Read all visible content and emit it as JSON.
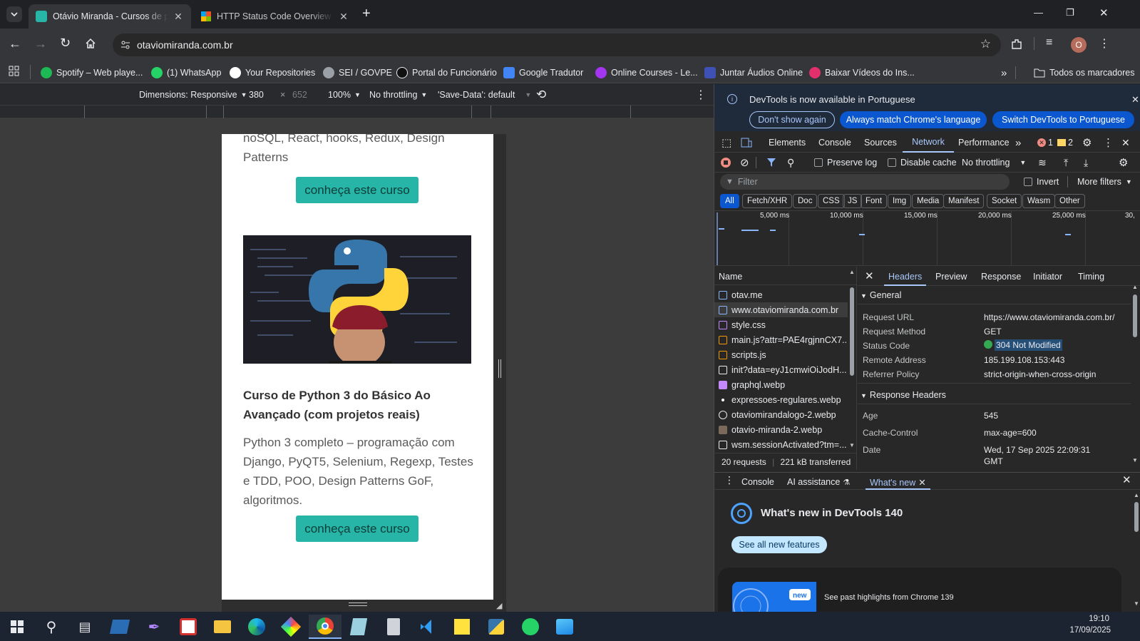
{
  "tabs": [
    {
      "title": "Otávio Miranda - Cursos de pro",
      "active": true
    },
    {
      "title": "HTTP Status Code Overview - In",
      "active": false
    }
  ],
  "new_tab": "+",
  "window": {
    "minimize": "—",
    "maximize": "❐",
    "close": "✕"
  },
  "omnibox": {
    "url": "otaviomiranda.com.br"
  },
  "profile_initial": "O",
  "bookmarks": [
    {
      "label": "Spotify – Web playe...",
      "color": "#1db954"
    },
    {
      "label": "(1) WhatsApp",
      "color": "#25d366"
    },
    {
      "label": "Your Repositories",
      "color": "#ffffff"
    },
    {
      "label": "SEI / GOVPE",
      "color": "#9aa0a6"
    },
    {
      "label": "Portal do Funcionário",
      "color": "#111111"
    },
    {
      "label": "Google Tradutor",
      "color": "#4285f4"
    },
    {
      "label": "Online Courses - Le...",
      "color": "#a435f0"
    },
    {
      "label": "Juntar Áudios Online",
      "color": "#3f51b5"
    },
    {
      "label": "Baixar Vídeos do Ins...",
      "color": "#e1306c"
    }
  ],
  "bookmarks_more": "»",
  "all_bookmarks": "Todos os marcadores",
  "device_toolbar": {
    "dimensions": "Dimensions: Responsive",
    "width": "380",
    "times": "×",
    "height": "652",
    "zoom": "100%",
    "throttle": "No throttling",
    "savedata": "'Save-Data': default"
  },
  "page": {
    "top_text_1": "noSQL, React, hooks, Redux, Design",
    "top_text_2": "Patterns",
    "button_1": "conheça este curso",
    "course_title": "Curso de Python 3 do Básico Ao Avançado (com projetos reais)",
    "course_desc": "Python 3 completo – programação com Django, PyQT5, Selenium, Regexp, Testes e TDD, POO, Design Patterns GoF, algoritmos.",
    "button_2": "conheça este curso"
  },
  "devtools": {
    "banner_text": "DevTools is now available in Portuguese",
    "banner_btn_1": "Don't show again",
    "banner_btn_2": "Always match Chrome's language",
    "banner_btn_3": "Switch DevTools to Portuguese",
    "tabs": [
      "Elements",
      "Console",
      "Sources",
      "Network",
      "Performance"
    ],
    "more_tabs": "»",
    "errors": "1",
    "warnings": "2",
    "preserve_log": "Preserve log",
    "disable_cache": "Disable cache",
    "throttle": "No throttling",
    "filter_placeholder": "Filter",
    "invert": "Invert",
    "more_filters": "More filters",
    "type_filters": [
      "All",
      "Fetch/XHR",
      "Doc",
      "CSS",
      "JS",
      "Font",
      "Img",
      "Media",
      "Manifest",
      "Socket",
      "Wasm",
      "Other"
    ],
    "timeline_ticks": [
      "5,000 ms",
      "10,000 ms",
      "15,000 ms",
      "20,000 ms",
      "25,000 ms",
      "30,"
    ],
    "list_header": "Name",
    "requests": [
      "otav.me",
      "www.otaviomiranda.com.br",
      "style.css",
      "main.js?attr=PAE4rgjnnCX7...",
      "scripts.js",
      "init?data=eyJ1cmwiOiJodH...",
      "graphql.webp",
      "expressoes-regulares.webp",
      "otaviomirandalogo-2.webp",
      "otavio-miranda-2.webp",
      "wsm.sessionActivated?tm=..."
    ],
    "summary_requests": "20 requests",
    "summary_transferred": "221 kB transferred",
    "detail_tabs": [
      "Headers",
      "Preview",
      "Response",
      "Initiator",
      "Timing"
    ],
    "general_title": "General",
    "general": [
      {
        "k": "Request URL",
        "v": "https://www.otaviomiranda.com.br/"
      },
      {
        "k": "Request Method",
        "v": "GET"
      },
      {
        "k": "Status Code",
        "v": "304 Not Modified"
      },
      {
        "k": "Remote Address",
        "v": "185.199.108.153:443"
      },
      {
        "k": "Referrer Policy",
        "v": "strict-origin-when-cross-origin"
      }
    ],
    "response_title": "Response Headers",
    "response": [
      {
        "k": "Age",
        "v": "545"
      },
      {
        "k": "Cache-Control",
        "v": "max-age=600"
      },
      {
        "k": "Date",
        "v": "Wed, 17 Sep 2025 22:09:31"
      },
      {
        "k": "",
        "v": "GMT"
      }
    ],
    "drawer_tabs": [
      "Console",
      "AI assistance",
      "What's new"
    ],
    "whatsnew_title": "What's new in DevTools 140",
    "whatsnew_btn": "See all new features",
    "new_badge": "new",
    "highlights": "See past highlights from Chrome 139"
  },
  "taskbar": {
    "time": "19:10",
    "date": "17/09/2025"
  }
}
